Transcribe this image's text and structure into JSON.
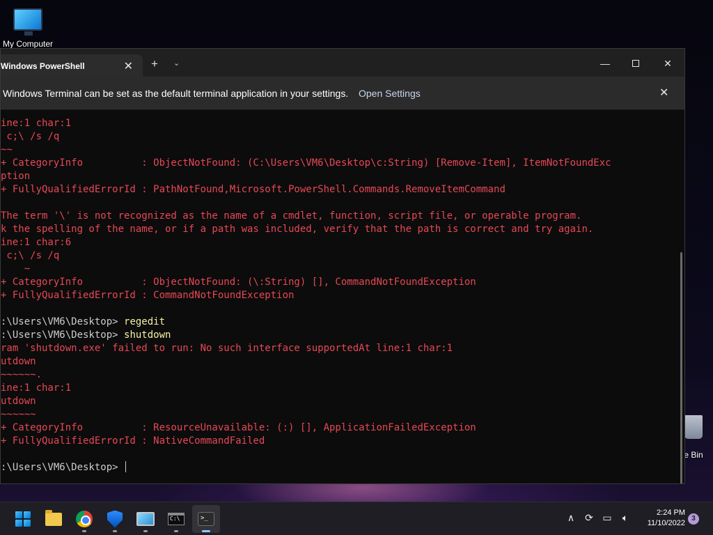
{
  "desktop": {
    "icons": [
      {
        "label": "My Computer"
      },
      {
        "label": "e Bin"
      }
    ]
  },
  "window": {
    "tab_title": "Windows PowerShell",
    "tab_close": "✕",
    "new_tab": "+",
    "dropdown": "⌄",
    "minimize": "—",
    "close": "✕"
  },
  "infobar": {
    "message": "Windows Terminal can be set as the default terminal application in your settings.",
    "link": "Open Settings",
    "close": "✕"
  },
  "console": {
    "lines": [
      {
        "text": "ine:1 char:1",
        "kind": "error"
      },
      {
        "text": " c;\\ /s /q",
        "kind": "error"
      },
      {
        "text": "~~",
        "kind": "error"
      },
      {
        "text": "+ CategoryInfo          : ObjectNotFound: (C:\\Users\\VM6\\Desktop\\c:String) [Remove-Item], ItemNotFoundExc",
        "kind": "error"
      },
      {
        "text": "ption",
        "kind": "error"
      },
      {
        "text": "+ FullyQualifiedErrorId : PathNotFound,Microsoft.PowerShell.Commands.RemoveItemCommand",
        "kind": "error"
      },
      {
        "text": "",
        "kind": "error"
      },
      {
        "text": "The term '\\' is not recognized as the name of a cmdlet, function, script file, or operable program.",
        "kind": "error"
      },
      {
        "text": "k the spelling of the name, or if a path was included, verify that the path is correct and try again.",
        "kind": "error"
      },
      {
        "text": "ine:1 char:6",
        "kind": "error"
      },
      {
        "text": " c;\\ /s /q",
        "kind": "error"
      },
      {
        "text": "    ~",
        "kind": "error"
      },
      {
        "text": "+ CategoryInfo          : ObjectNotFound: (\\:String) [], CommandNotFoundException",
        "kind": "error"
      },
      {
        "text": "+ FullyQualifiedErrorId : CommandNotFoundException",
        "kind": "error"
      },
      {
        "text": "",
        "kind": "error"
      },
      {
        "text": ":\\Users\\VM6\\Desktop> ",
        "kind": "prompt",
        "cmd": "regedit"
      },
      {
        "text": ":\\Users\\VM6\\Desktop> ",
        "kind": "prompt",
        "cmd": "shutdown"
      },
      {
        "text": "ram 'shutdown.exe' failed to run: No such interface supportedAt line:1 char:1",
        "kind": "error"
      },
      {
        "text": "utdown",
        "kind": "error"
      },
      {
        "text": "~~~~~~.",
        "kind": "error"
      },
      {
        "text": "ine:1 char:1",
        "kind": "error"
      },
      {
        "text": "utdown",
        "kind": "error"
      },
      {
        "text": "~~~~~~",
        "kind": "error"
      },
      {
        "text": "+ CategoryInfo          : ResourceUnavailable: (:) [], ApplicationFailedException",
        "kind": "error"
      },
      {
        "text": "+ FullyQualifiedErrorId : NativeCommandFailed",
        "kind": "error"
      },
      {
        "text": "",
        "kind": "error"
      },
      {
        "text": ":\\Users\\VM6\\Desktop> ",
        "kind": "prompt",
        "cmd": "",
        "cursor": true
      }
    ]
  },
  "taskbar": {
    "apps": [
      {
        "name": "start-icon"
      },
      {
        "name": "file-explorer-icon"
      },
      {
        "name": "chrome-icon"
      },
      {
        "name": "security-shield-icon"
      },
      {
        "name": "remote-desktop-icon"
      },
      {
        "name": "command-prompt-icon"
      },
      {
        "name": "terminal-icon"
      }
    ],
    "tray": {
      "chevron": "∧",
      "time": "2:24 PM",
      "date": "11/10/2022",
      "notifications": "3"
    }
  },
  "colors": {
    "error": "#e74856",
    "prompt": "#cccccc",
    "command": "#f9f1a5",
    "terminal_bg": "#0c0c0c"
  }
}
